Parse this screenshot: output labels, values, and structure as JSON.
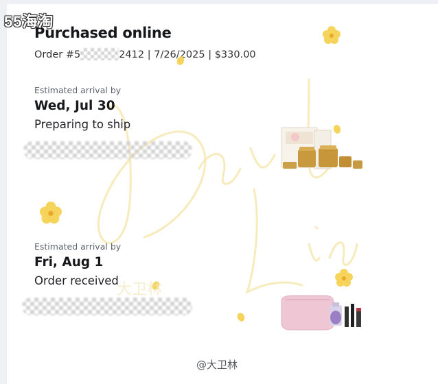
{
  "watermark": {
    "top_left": "55海淘",
    "bottom_handle": "@大卫林",
    "faint_cn": "大卫林"
  },
  "header": {
    "title": "Purchased online",
    "order_prefix": "Order #5",
    "order_suffix": "2412",
    "date": "7/26/2025",
    "total": "$330.00",
    "separator": "|"
  },
  "shipments": [
    {
      "estimate_label": "Estimated arrival by",
      "date": "Wed, Jul 30",
      "status": "Preparing to ship",
      "product_icon": "lancome-skincare-set-image"
    },
    {
      "estimate_label": "Estimated arrival by",
      "date": "Fri, Aug 1",
      "status": "Order received",
      "product_icon": "makeup-pouch-set-image"
    }
  ],
  "colors": {
    "background": "#eef0f3",
    "card": "#ffffff",
    "text": "#15171a",
    "muted": "#5f6470",
    "flower": "#f6d35a",
    "signature": "#f6e7b0"
  }
}
